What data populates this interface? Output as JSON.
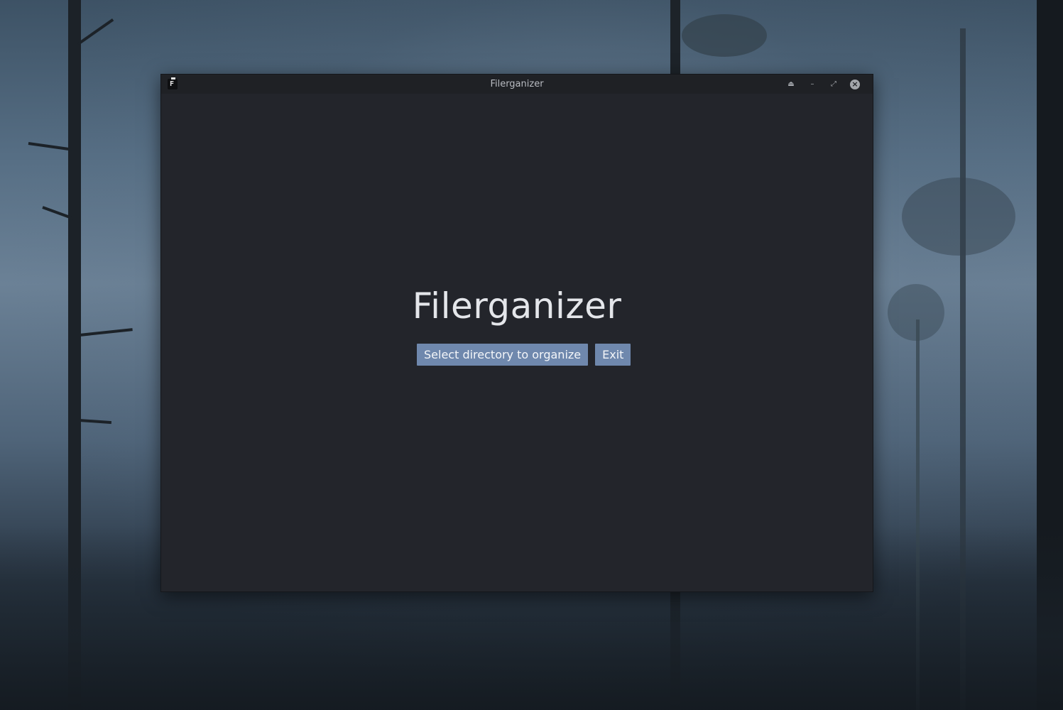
{
  "window": {
    "title": "Filerganizer",
    "controls": {
      "keep_above_icon": "eject-icon",
      "minimize_icon": "minimize-icon",
      "maximize_icon": "restore-icon",
      "close_icon": "close-icon"
    }
  },
  "main": {
    "heading": "Filerganizer",
    "select_button_label": "Select directory to organize",
    "exit_button_label": "Exit"
  },
  "colors": {
    "window_bg": "#23252b",
    "titlebar_bg": "#1f2125",
    "button_bg": "#6f88ad",
    "heading_text": "#e4e6ea"
  }
}
